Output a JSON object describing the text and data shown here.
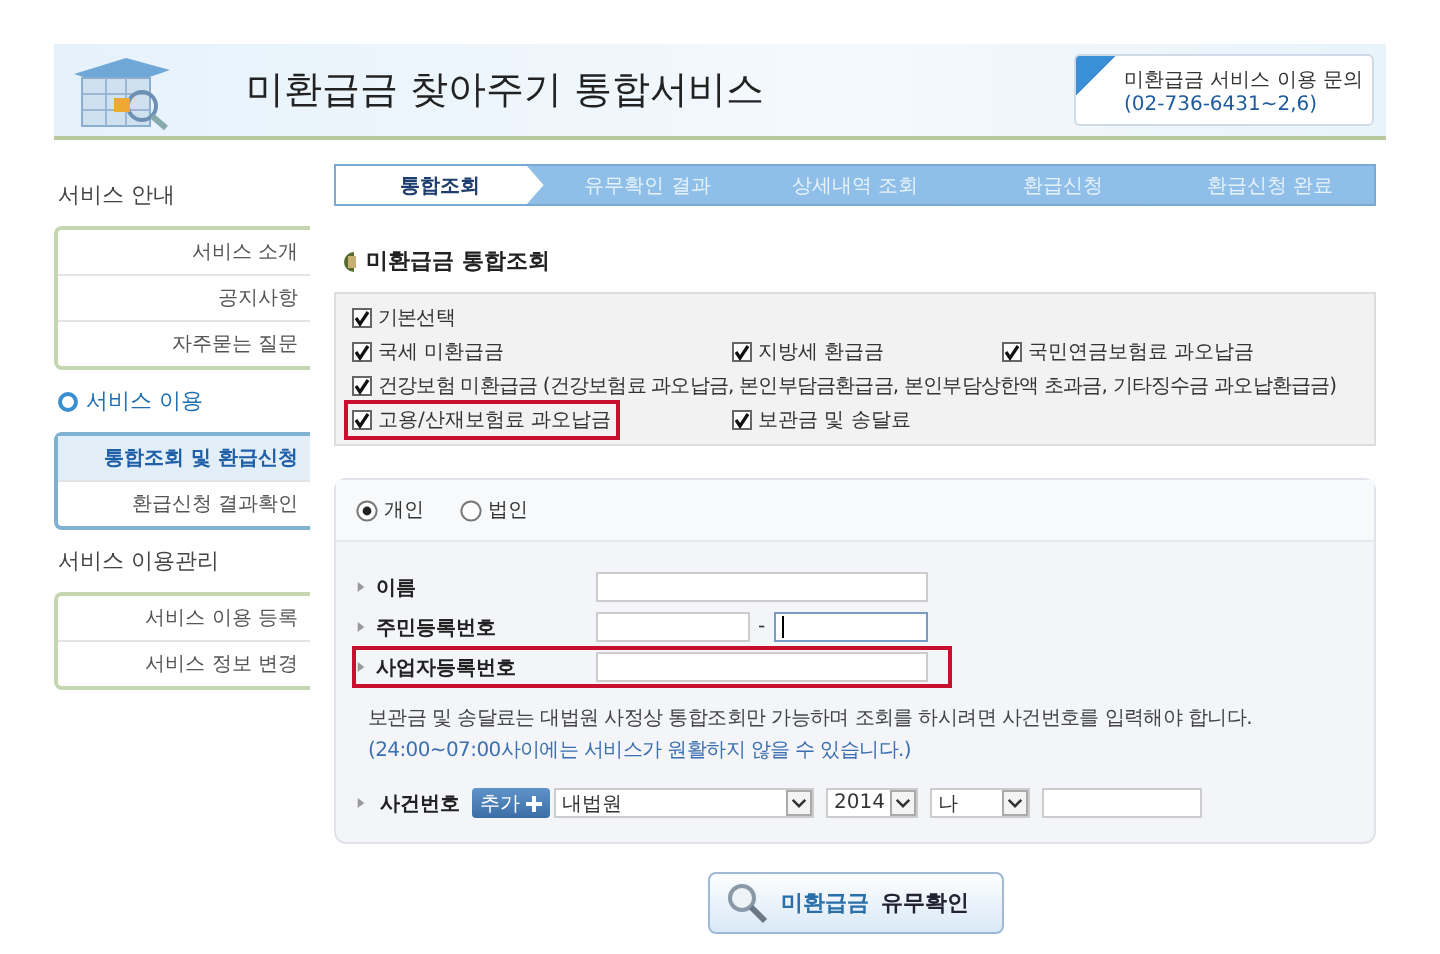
{
  "header": {
    "title": "미환급금 찾아주기 통합서비스",
    "contact_label": "미환급금 서비스 이용 문의",
    "contact_phone": "(02-736-6431~2,6)"
  },
  "sidebar": {
    "sections": [
      {
        "title": "서비스 안내",
        "selected": false,
        "items": [
          {
            "label": "서비스 소개",
            "selected": false
          },
          {
            "label": "공지사항",
            "selected": false
          },
          {
            "label": "자주묻는 질문",
            "selected": false
          }
        ]
      },
      {
        "title": "서비스 이용",
        "selected": true,
        "items": [
          {
            "label": "통합조회 및 환급신청",
            "selected": true
          },
          {
            "label": "환급신청 결과확인",
            "selected": false
          }
        ]
      },
      {
        "title": "서비스 이용관리",
        "selected": false,
        "items": [
          {
            "label": "서비스 이용 등록",
            "selected": false
          },
          {
            "label": "서비스 정보 변경",
            "selected": false
          }
        ]
      }
    ]
  },
  "steps": [
    {
      "label": "통합조회",
      "selected": true
    },
    {
      "label": "유무확인 결과",
      "selected": false
    },
    {
      "label": "상세내역 조회",
      "selected": false
    },
    {
      "label": "환급신청",
      "selected": false
    },
    {
      "label": "환급신청 완료",
      "selected": false
    }
  ],
  "section_title": "미환급금 통합조회",
  "option_rows": [
    {
      "options": [
        {
          "label": "기본선택",
          "checked": true,
          "highlighted": false
        }
      ]
    },
    {
      "options": [
        {
          "label": "국세 미환급금",
          "checked": true,
          "highlighted": false
        },
        {
          "label": "지방세 환급금",
          "checked": true,
          "highlighted": false
        },
        {
          "label": "국민연금보험료 과오납금",
          "checked": true,
          "highlighted": false
        }
      ]
    },
    {
      "options": [
        {
          "label": "건강보험 미환급금 (건강보험료 과오납금, 본인부담금환급금, 본인부담상한액 초과금, 기타징수금 과오납환급금)",
          "checked": true,
          "highlighted": false
        }
      ]
    },
    {
      "options": [
        {
          "label": "고용/산재보험료 과오납금",
          "checked": true,
          "highlighted": true
        },
        {
          "label": "보관금 및 송달료",
          "checked": true,
          "highlighted": false
        }
      ]
    }
  ],
  "person_types": [
    {
      "label": "개인",
      "selected": true
    },
    {
      "label": "법인",
      "selected": false
    }
  ],
  "fields": [
    {
      "label": "이름",
      "kind": "single",
      "highlighted": false,
      "focused": false
    },
    {
      "label": "주민등록번호",
      "kind": "split",
      "separator": "-",
      "highlighted": false,
      "focused": true
    },
    {
      "label": "사업자등록번호",
      "kind": "single",
      "highlighted": true,
      "focused": false
    }
  ],
  "notes": [
    {
      "text": "보관금 및 송달료는 대법원 사정상 통합조회만 가능하며 조회를 하시려면 사건번호를 입력해야 합니다.",
      "kind": "plain"
    },
    {
      "text": "(24:00~07:00사이에는 서비스가 원활하지 않을 수 있습니다.)",
      "kind": "hint"
    }
  ],
  "case_number": {
    "label": "사건번호",
    "add_button": "추가",
    "court": "내법원",
    "year": "2014",
    "type": "나"
  },
  "submit": {
    "prefix": "미환급금",
    "main": "유무확인"
  }
}
